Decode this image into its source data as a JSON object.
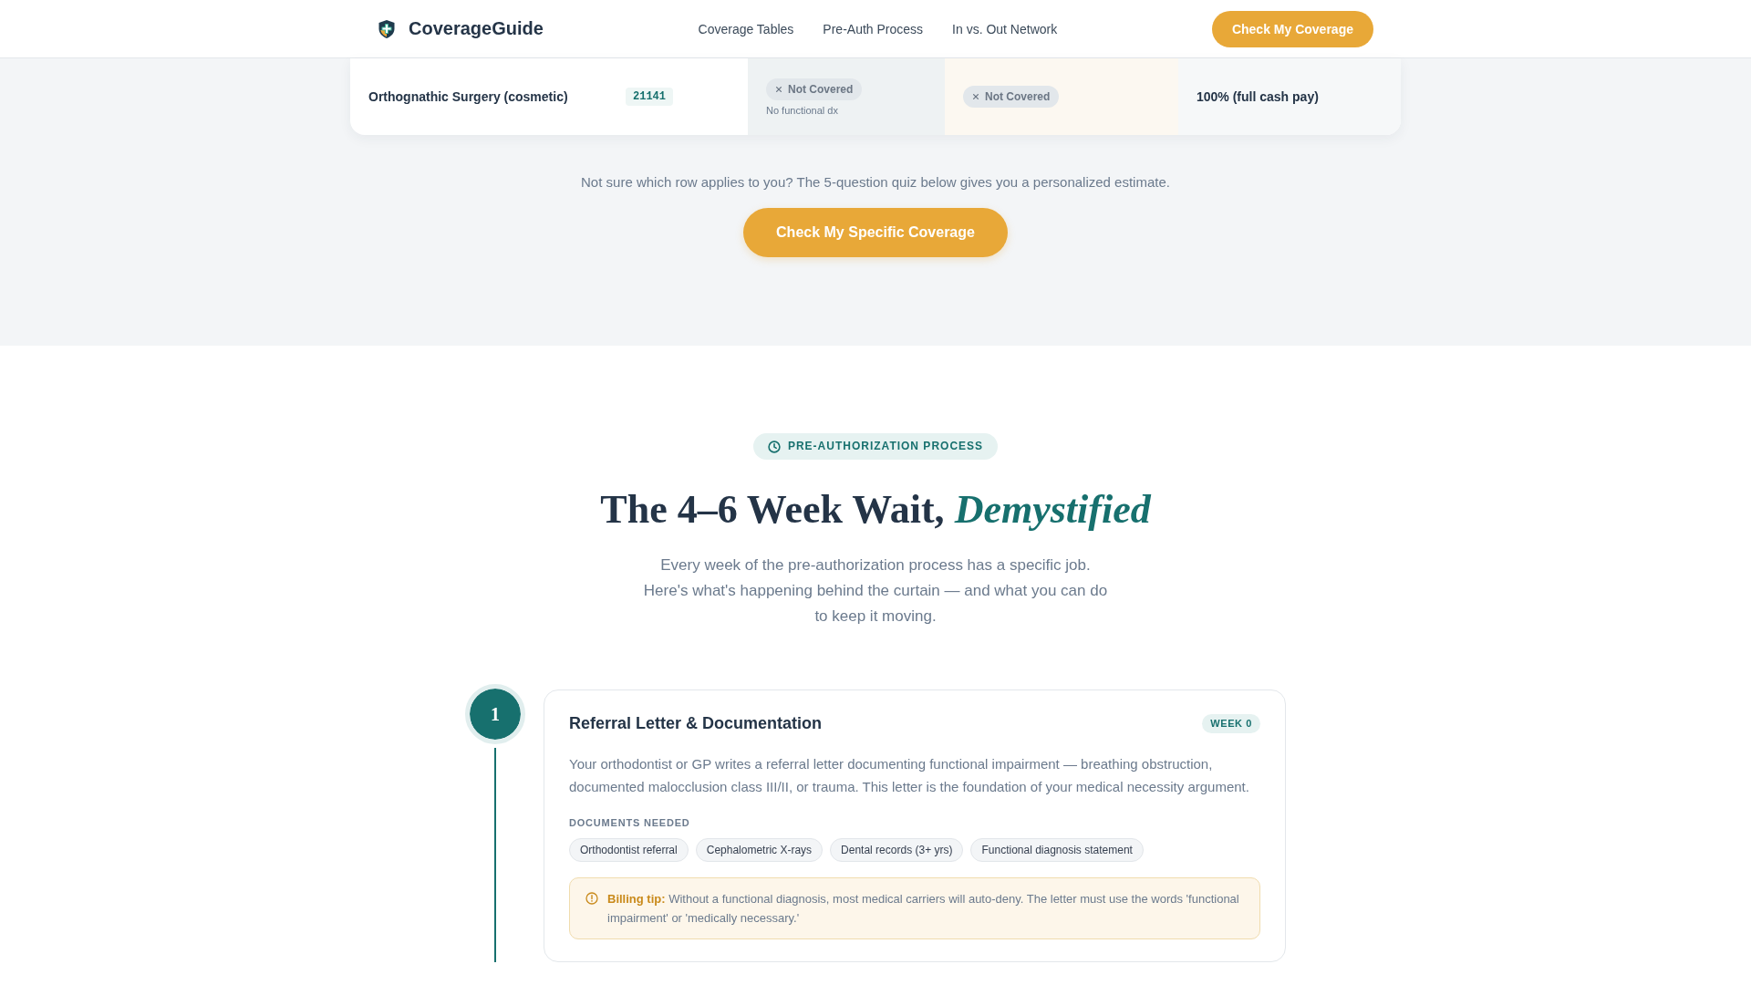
{
  "header": {
    "logo": "CoverageGuide",
    "nav": [
      "Coverage Tables",
      "Pre-Auth Process",
      "In vs. Out Network"
    ],
    "cta": "Check My Coverage"
  },
  "coverage_table": {
    "rows": [
      {
        "column_1": "Orthognathic Surgery (cosmetic)",
        "column_2": "21141",
        "column_3": {
          "status": "Not Covered",
          "covered": false,
          "note": "No functional dx"
        },
        "column_4": {
          "status": "Not Covered",
          "covered": false
        },
        "column_5": "100% (full cash pay)"
      }
    ]
  },
  "quiz_prompt": {
    "text": "Not sure which row applies to you? The 5-question quiz below gives you a personalized estimate.",
    "button": "Check My Specific Coverage"
  },
  "pre_auth_section": {
    "eyebrow": "PRE-AUTHORIZATION PROCESS",
    "title": "The 4–6 Week Wait, *Demystified*",
    "subtitle": "Every week of the pre-authorization process has a specific job. Here's what's happening behind the curtain — and what you can do to keep it moving.",
    "steps": [
      {
        "number": "1",
        "title": "Referral Letter & Documentation",
        "week": "WEEK 0",
        "description": "Your orthodontist or GP writes a referral letter documenting functional impairment — breathing obstruction, documented malocclusion class III/II, or trauma. This letter is the foundation of your medical necessity argument.",
        "documents_label": "DOCUMENTS NEEDED",
        "documents": [
          "Orthodontist referral",
          "Cephalometric X-rays",
          "Dental records (3+ yrs)",
          "Functional diagnosis statement"
        ],
        "tip": "**Billing tip:** Without a functional diagnosis, most medical carriers will auto-deny. The letter must use the words 'functional impairment' or 'medically necessary.'"
      }
    ]
  }
}
